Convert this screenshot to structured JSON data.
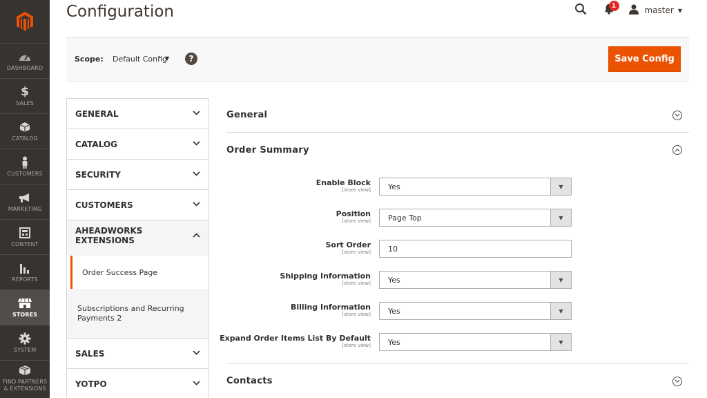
{
  "nav": {
    "items": [
      {
        "label": "DASHBOARD",
        "icon": "dashboard-icon"
      },
      {
        "label": "SALES",
        "icon": "dollar-icon"
      },
      {
        "label": "CATALOG",
        "icon": "cube-icon"
      },
      {
        "label": "CUSTOMERS",
        "icon": "person-icon"
      },
      {
        "label": "MARKETING",
        "icon": "megaphone-icon"
      },
      {
        "label": "CONTENT",
        "icon": "content-icon"
      },
      {
        "label": "REPORTS",
        "icon": "bar-chart-icon"
      },
      {
        "label": "STORES",
        "icon": "store-icon"
      },
      {
        "label": "SYSTEM",
        "icon": "gear-icon"
      },
      {
        "label": "FIND PARTNERS & EXTENSIONS",
        "icon": "box-icon"
      }
    ],
    "active": "STORES"
  },
  "header": {
    "title": "Configuration",
    "notification_count": "1",
    "user": "master"
  },
  "scope": {
    "label": "Scope:",
    "value": "Default Config",
    "help": "?",
    "save_label": "Save Config"
  },
  "tabs": {
    "general": "GENERAL",
    "catalog": "CATALOG",
    "security": "SECURITY",
    "customers": "CUSTOMERS",
    "aheadworks": "AHEADWORKS EXTENSIONS",
    "sub_order_success": "Order Success Page",
    "sub_subscriptions": "Subscriptions and Recurring Payments 2",
    "sales": "SALES",
    "yotpo": "YOTPO"
  },
  "main": {
    "section_general": "General",
    "section_order_summary": "Order Summary",
    "section_contacts": "Contacts",
    "fields": [
      {
        "label": "Enable Block",
        "scope": "[store view]",
        "value": "Yes"
      },
      {
        "label": "Position",
        "scope": "[store view]",
        "value": "Page Top"
      },
      {
        "label": "Sort Order",
        "scope": "[store view]",
        "value": "10"
      },
      {
        "label": "Shipping Information",
        "scope": "[store view]",
        "value": "Yes"
      },
      {
        "label": "Billing Information",
        "scope": "[store view]",
        "value": "Yes"
      },
      {
        "label": "Expand Order Items List By Default",
        "scope": "[store view]",
        "value": "Yes"
      }
    ]
  },
  "colors": {
    "accent": "#eb5202",
    "nav_bg": "#373330",
    "badge": "#e22626"
  }
}
